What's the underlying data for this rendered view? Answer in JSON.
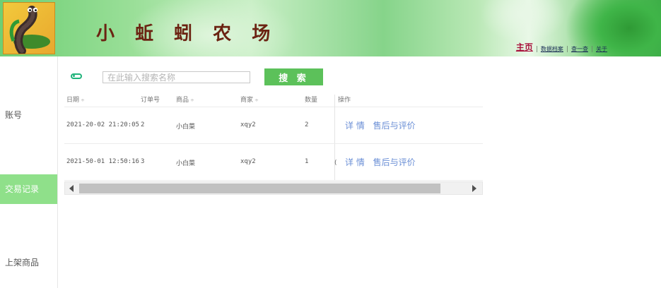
{
  "header": {
    "brand": "小 蚯 蚓 农 场",
    "nav": {
      "home": "主页",
      "items": [
        "数据档案",
        "查一查",
        "关于"
      ]
    }
  },
  "sidebar": {
    "items": [
      {
        "label": "账号",
        "active": false
      },
      {
        "label": "交易记录",
        "active": true
      },
      {
        "label": "上架商品",
        "active": false
      }
    ]
  },
  "search": {
    "placeholder": "在此输入搜索名称",
    "value": "",
    "button_label": "搜 索"
  },
  "table": {
    "columns": [
      "日期",
      "订单号",
      "商品",
      "商家",
      "数量",
      "操作"
    ],
    "rows": [
      {
        "date": "2021-20-02 21:20:05",
        "order_no": "2",
        "product": "小白菜",
        "merchant": "xqy2",
        "quantity": "2",
        "extra": ""
      },
      {
        "date": "2021-50-01 12:50:16",
        "order_no": "3",
        "product": "小白菜",
        "merchant": "xqy2",
        "quantity": "1",
        "extra": "("
      }
    ],
    "actions": [
      "详 情",
      "售后与评价"
    ]
  },
  "colors": {
    "accent_green": "#5cc15a",
    "sidebar_active": "#8fe08a",
    "link_blue": "#6b8fd6",
    "home_red": "#a8123c",
    "brand_brown": "#6b2312"
  }
}
